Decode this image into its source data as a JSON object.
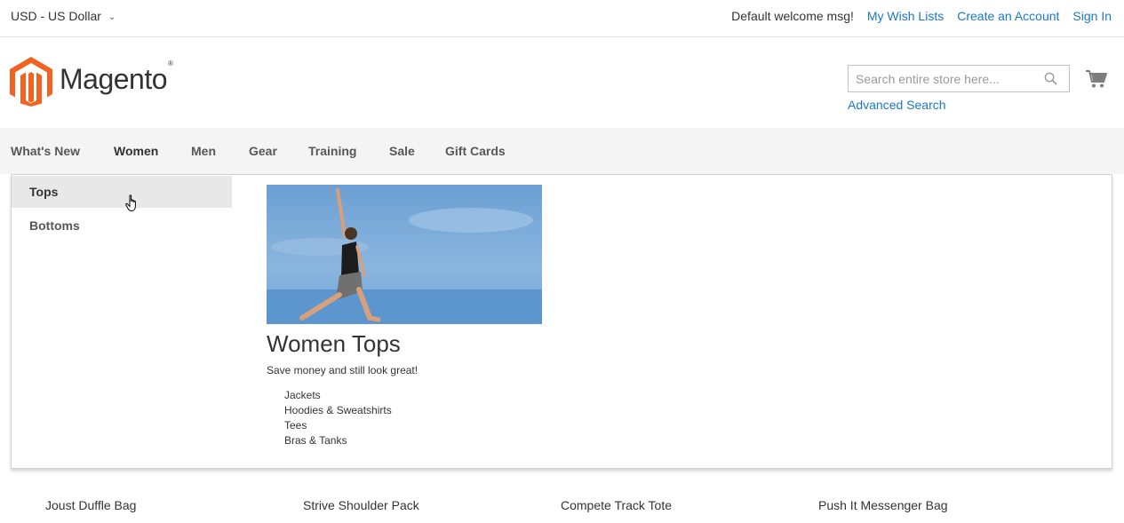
{
  "topbar": {
    "currency": "USD - US Dollar",
    "welcome": "Default welcome msg!",
    "links": [
      "My Wish Lists",
      "Create an Account",
      "Sign In"
    ]
  },
  "header": {
    "logo_text": "Magento",
    "logo_mark": "®",
    "search_placeholder": "Search entire store here...",
    "advanced_search": "Advanced Search"
  },
  "nav": {
    "items": [
      "What's New",
      "Women",
      "Men",
      "Gear",
      "Training",
      "Sale",
      "Gift Cards"
    ],
    "active": "Women"
  },
  "dropdown": {
    "subitems": [
      "Tops",
      "Bottoms"
    ],
    "hovered": "Tops",
    "promo_title": "Women Tops",
    "promo_subtitle": "Save money and still look great!",
    "promo_links": [
      "Jackets",
      "Hoodies & Sweatshirts",
      "Tees",
      "Bras & Tanks"
    ]
  },
  "products": [
    "Joust Duffle Bag",
    "Strive Shoulder Pack",
    "Compete Track Tote",
    "Push It Messenger Bag"
  ],
  "colors": {
    "link": "#1979c3",
    "logo_orange": "#f26322",
    "nav_bg": "#f4f4f4",
    "hover_bg": "#e8e8e8"
  }
}
